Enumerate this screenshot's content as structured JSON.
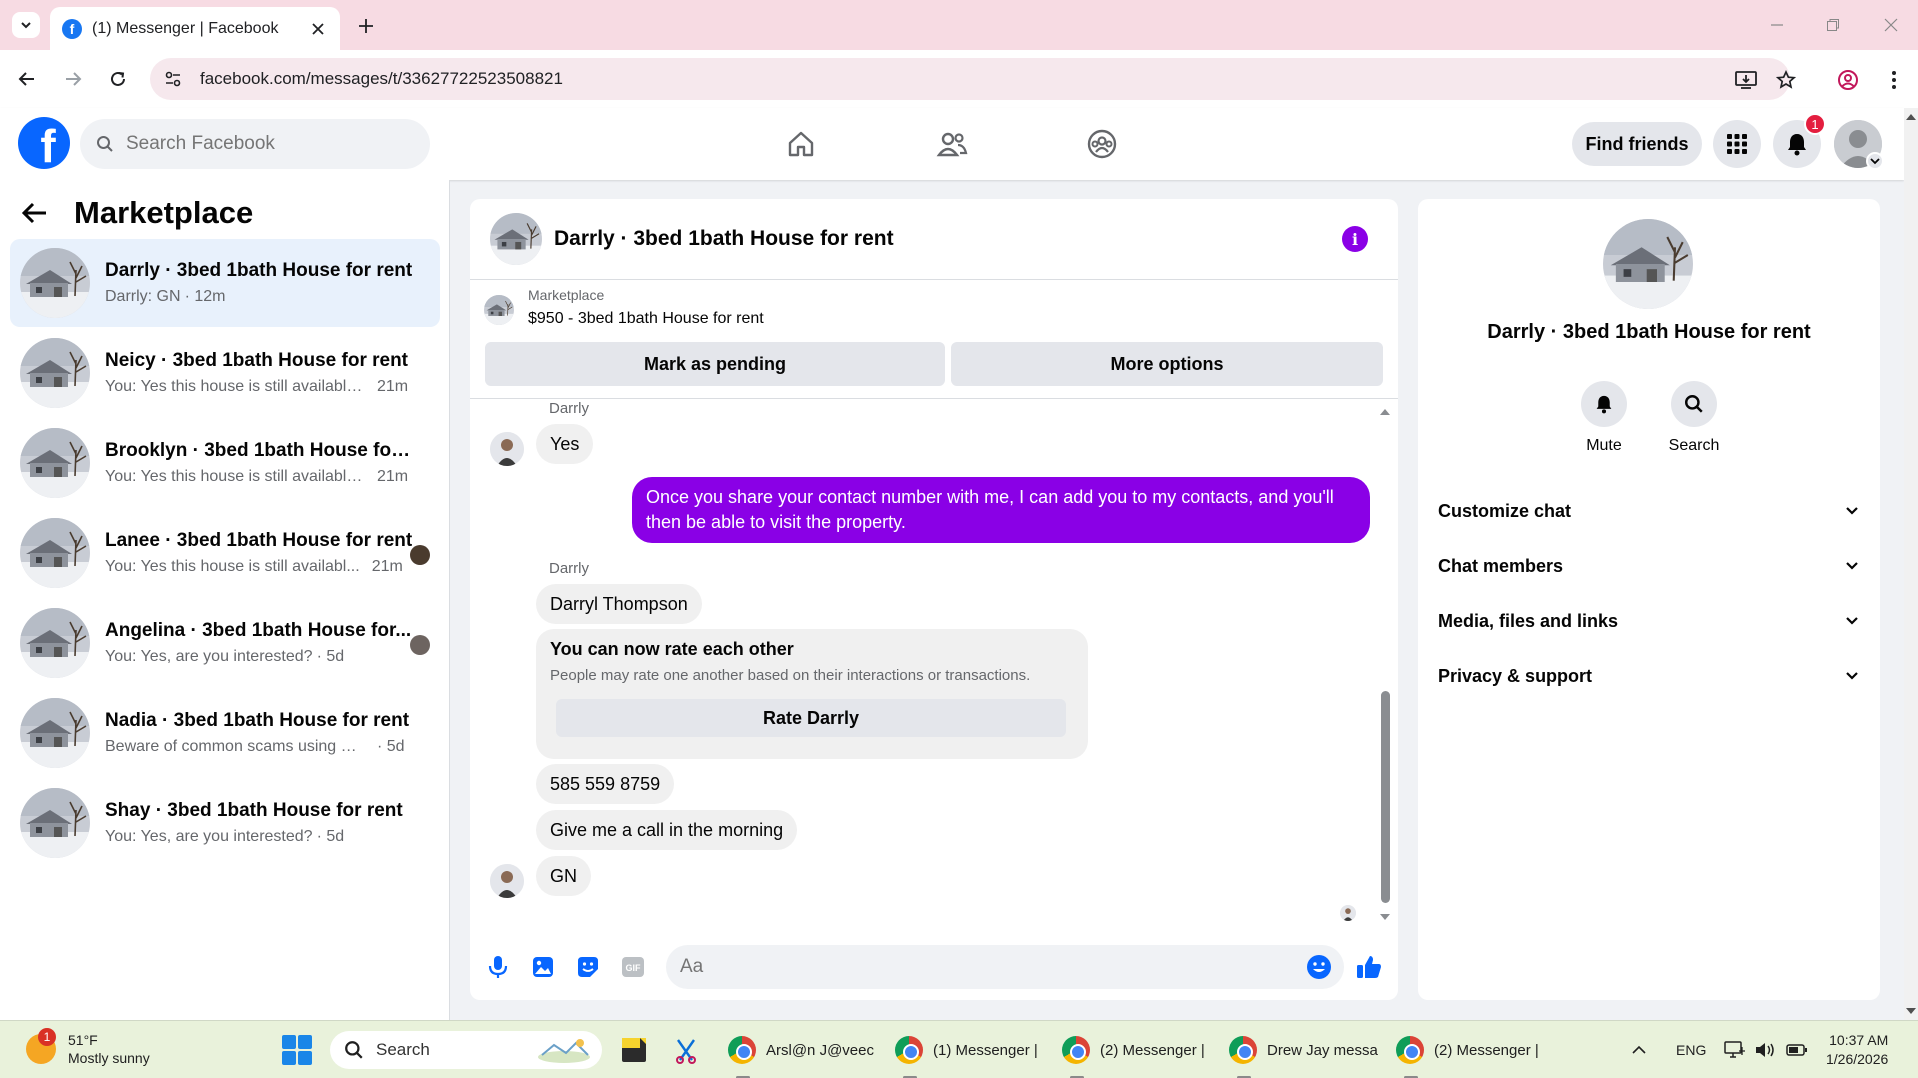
{
  "browser": {
    "tab_title": "(1) Messenger | Facebook",
    "url": "facebook.com/messages/t/33627722523508821"
  },
  "fb": {
    "search_placeholder": "Search Facebook",
    "find_friends": "Find friends",
    "notification_count": "1"
  },
  "sidebar": {
    "title": "Marketplace",
    "conversations": [
      {
        "name": "Darrly · 3bed 1bath House for rent",
        "preview": "Darrly: GN",
        "time": "· 12m",
        "active": true
      },
      {
        "name": "Neicy · 3bed 1bath House for rent",
        "preview": "You: Yes this house is still available f...",
        "time": "21m"
      },
      {
        "name": "Brooklyn · 3bed 1bath House for r...",
        "preview": "You: Yes this house is still available f...",
        "time": "21m"
      },
      {
        "name": "Lanee · 3bed 1bath House for rent",
        "preview": "You: Yes this house is still availabl...",
        "time": "21m"
      },
      {
        "name": "Angelina · 3bed 1bath House for...",
        "preview": "You: Yes, are you interested?",
        "time": "· 5d"
      },
      {
        "name": "Nadia · 3bed 1bath House for rent",
        "preview": "Beware of common scams using pay...",
        "time": "· 5d"
      },
      {
        "name": "Shay · 3bed 1bath House for rent",
        "preview": "You: Yes, are you interested?",
        "time": "· 5d"
      }
    ]
  },
  "chat": {
    "title": "Darrly · 3bed 1bath House for rent",
    "listing_category": "Marketplace",
    "listing_price": "$950 - 3bed 1bath House for rent",
    "mark_pending": "Mark as pending",
    "more_options": "More options",
    "messages": {
      "sender1": "Darrly",
      "m1": "Yes",
      "mine": "Once you share your contact number with me, I can add you to my contacts, and you'll then be able to visit the property.",
      "sender2": "Darrly",
      "m2": "Darryl Thompson",
      "rate_title": "You can now rate each other",
      "rate_desc": "People may rate one another based on their interactions or transactions.",
      "rate_button": "Rate Darrly",
      "m3": "585 559 8759",
      "m4": "Give me a call in the morning",
      "m5": "GN"
    },
    "composer_placeholder": "Aa"
  },
  "info": {
    "name": "Darrly · 3bed 1bath House for rent",
    "mute": "Mute",
    "search": "Search",
    "sections": [
      "Customize chat",
      "Chat members",
      "Media, files and links",
      "Privacy & support"
    ]
  },
  "taskbar": {
    "temp": "51°F",
    "weather": "Mostly sunny",
    "weather_badge": "1",
    "search": "Search",
    "apps": [
      "Arsl@n J@veec",
      "(1) Messenger |",
      "(2) Messenger |",
      "Drew Jay messa",
      "(2) Messenger |"
    ],
    "lang": "ENG",
    "time": "10:37 AM",
    "date": "1/26/2026"
  },
  "colors": {
    "accent": "#8a00e6",
    "fb_blue": "#0866ff",
    "active_row": "#e8f1fc"
  }
}
